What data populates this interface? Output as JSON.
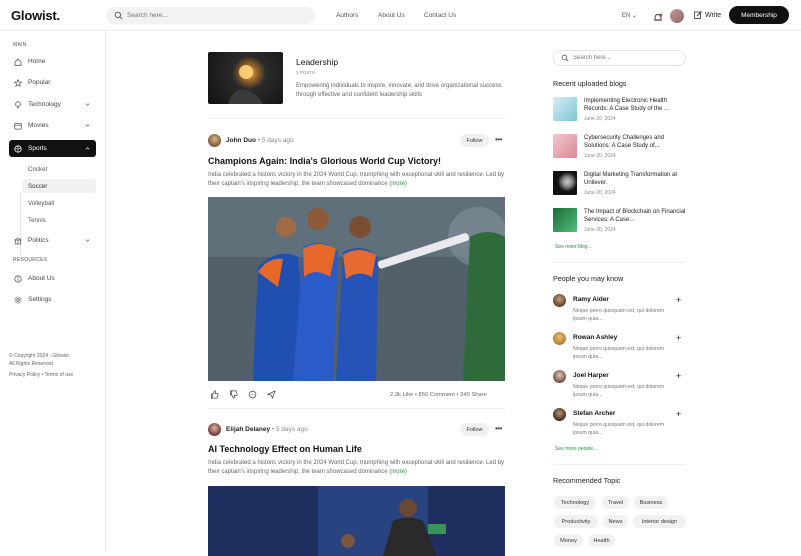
{
  "app": {
    "logo": "Glowist."
  },
  "header": {
    "search_placeholder": "Search here...",
    "nav": [
      "Authors",
      "About Us",
      "Contact Us"
    ],
    "language": "EN",
    "write_label": "Write",
    "membership_label": "Membership"
  },
  "sidebar": {
    "main_label": "MAIN",
    "items": [
      {
        "label": "Home",
        "icon": "home-icon"
      },
      {
        "label": "Popular",
        "icon": "star-icon"
      },
      {
        "label": "Technology",
        "icon": "bulb-icon"
      },
      {
        "label": "Movies",
        "icon": "film-icon"
      },
      {
        "label": "Sports",
        "icon": "ball-icon"
      }
    ],
    "sports_sub": [
      "Cricket",
      "Soccer",
      "Volleyball",
      "Tennis"
    ],
    "politics_label": "Politics",
    "resources_label": "RESOURCES",
    "resources": [
      {
        "label": "About Us",
        "icon": "info-icon"
      },
      {
        "label": "Settings",
        "icon": "gear-icon"
      }
    ],
    "footer": {
      "copyright": "© Copyright 2024 - Glowist.",
      "rights": "All Rights Reserved",
      "links": "Privacy Policy • Terms of use"
    }
  },
  "category": {
    "title": "Leadership",
    "posts": "3 POSTS",
    "description": "Empowering individuals to inspire, innovate, and drive organizational success through effective and confident leadership skills"
  },
  "posts": [
    {
      "author": "John Duo",
      "time": " • 5 days ago",
      "follow": "Follow",
      "title": "Champions Again: India's Glorious World Cup Victory!",
      "excerpt": "India celebrated a historic victory in the 2024 World Cup, triumphing with exceptional skill and resilience. Led by their captain's inspiring leadership, the team showcased dominance ",
      "more": "(more)",
      "likes": "2.3k Like",
      "comments": "850 Comment",
      "shares": "240 Share"
    },
    {
      "author": "Elijah Delaney",
      "time": " • 5 days ago",
      "follow": "Follow",
      "title": "AI Technology Effect on Human Life",
      "excerpt": "India celebrated a historic victory in the 2024 World Cup, triumphing with exceptional skill and resilience. Led by their captain's inspiring leadership, the team showcased dominance ",
      "more": "(more)"
    }
  ],
  "right": {
    "search_placeholder": "Search here...",
    "recent_heading": "Recent uploaded blogs",
    "blogs": [
      {
        "title": "Implementing Electronic Health Records: A Case Study of the ...",
        "date": "June 20, 2024"
      },
      {
        "title": "Cybersecurity Challenges and Solutions: A Case Study of...",
        "date": "June 20, 2024"
      },
      {
        "title": "Digital Marketing Transformation at Unilever.",
        "date": "June 20, 2024"
      },
      {
        "title": "The Impact of Blockchain on Financial Services: A Case...",
        "date": "June 20, 2024"
      }
    ],
    "see_more_blog": "See more blog...",
    "people_heading": "People you may know",
    "people": [
      {
        "name": "Ramy Aider",
        "bio": "Neque porro quisquam est, qui dolorem ipsum quia..."
      },
      {
        "name": "Rowan Ashley",
        "bio": "Neque porro quisquam est, qui dolorem ipsum quia..."
      },
      {
        "name": "Joel Harper",
        "bio": "Neque porro quisquam est, qui dolorem ipsum quia..."
      },
      {
        "name": "Stefan Archer",
        "bio": "Neque porro quisquam est, qui dolorem ipsum quia..."
      }
    ],
    "see_more_people": "See more people...",
    "topics_heading": "Recommended Topic",
    "topics": [
      "Technology",
      "Travel",
      "Business",
      "Productivity",
      "News",
      "Interior design",
      "Money",
      "Health"
    ]
  },
  "colors": {
    "accent": "#111111",
    "link": "#2a8f3a",
    "notification": "#e53935"
  }
}
